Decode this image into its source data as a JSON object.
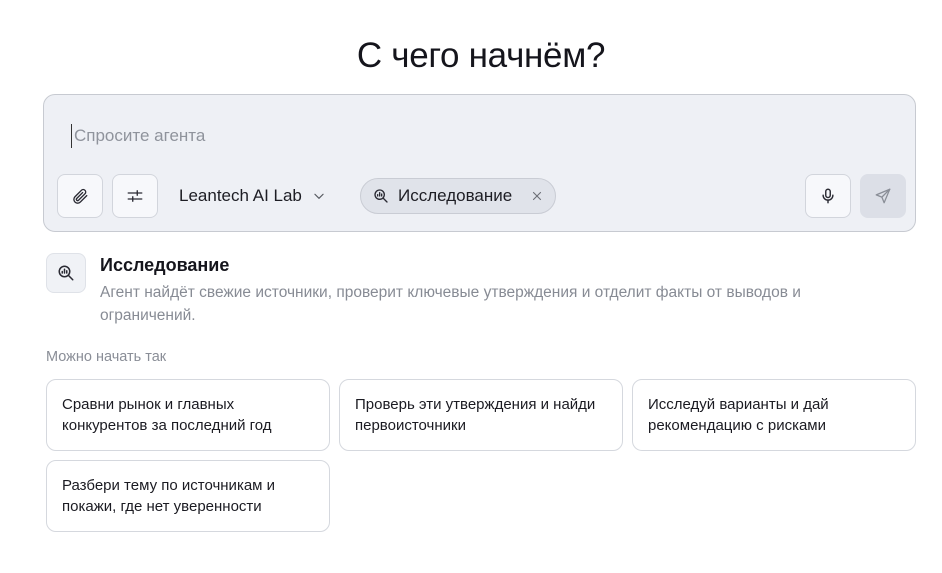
{
  "header": {
    "title": "С чего начнём?"
  },
  "composer": {
    "placeholder": "Спросите агента",
    "workspace_label": "Leantech AI Lab",
    "mode_chip_label": "Исследование",
    "icons": {
      "attach": "paperclip-icon",
      "settings": "sliders-icon",
      "dropdown": "chevron-down-icon",
      "mode": "research-icon",
      "remove": "close-icon",
      "mic": "microphone-icon",
      "send": "send-icon"
    }
  },
  "mode_info": {
    "title": "Исследование",
    "description": "Агент найдёт свежие источники, проверит ключевые утверждения и отделит факты от выводов и ограничений."
  },
  "suggestions": {
    "label": "Можно начать так",
    "items": [
      "Сравни рынок и главных конкурентов за последний год",
      "Проверь эти утверждения и найди первоисточники",
      "Исследуй варианты и дай рекомендацию с рисками",
      "Разбери тему по источникам и покажи, где нет уверенности"
    ]
  },
  "colors": {
    "composer_bg": "#eef0f5",
    "chip_bg": "#e0e3ea",
    "muted_text": "#878b94",
    "send_disabled_bg": "#dcdfe7"
  }
}
